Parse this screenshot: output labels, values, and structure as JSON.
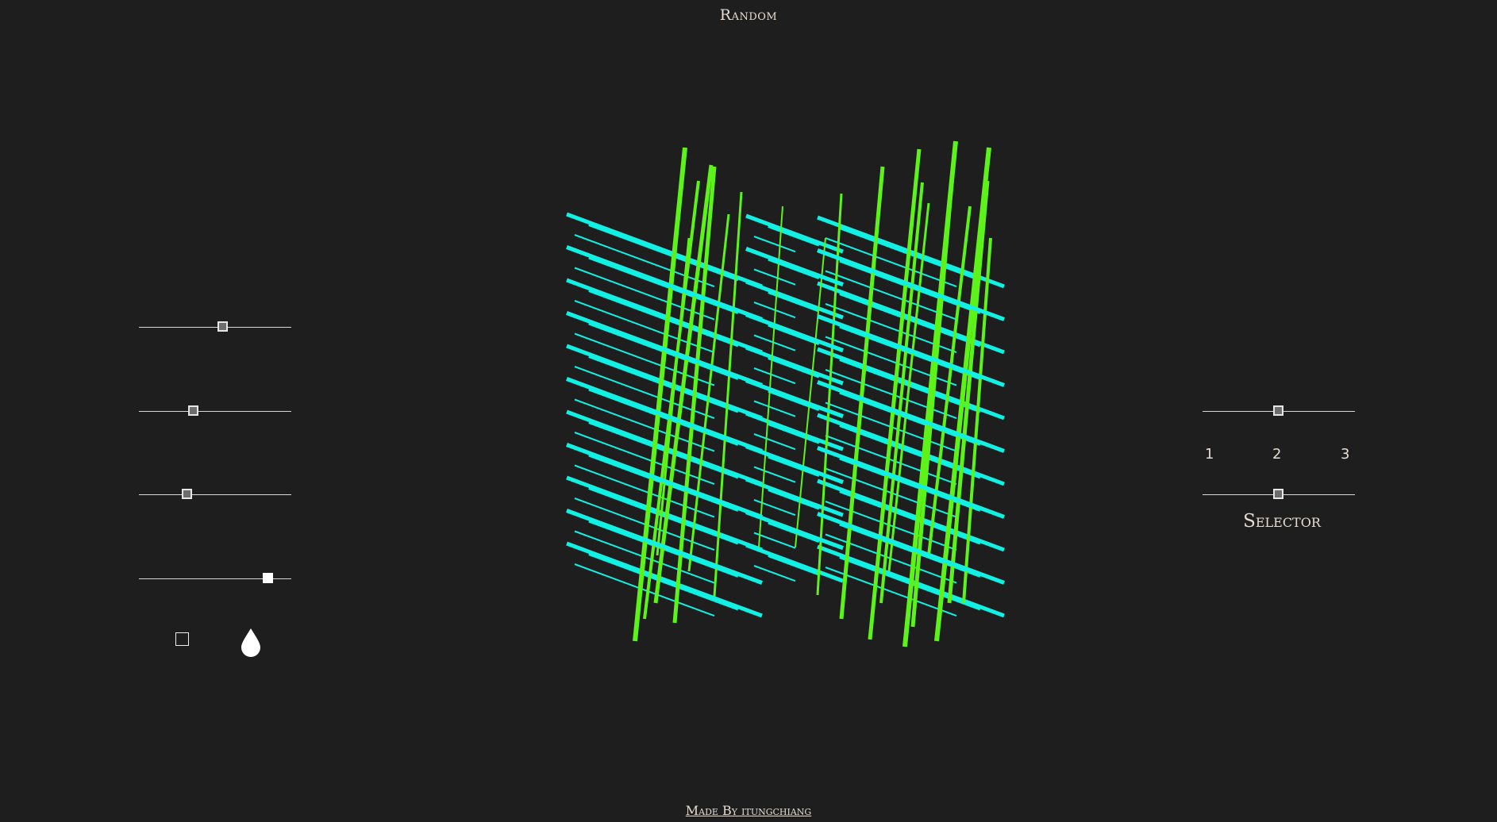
{
  "header": {
    "title": "Random"
  },
  "footer": {
    "credit": "Made By itungchiang"
  },
  "left_panel": {
    "sliders": [
      {
        "name": "slider-1",
        "value": 0.55
      },
      {
        "name": "slider-2",
        "value": 0.36
      },
      {
        "name": "slider-3",
        "value": 0.32
      },
      {
        "name": "slider-4",
        "value": 0.85
      }
    ],
    "buttons": [
      {
        "name": "square-shape-button",
        "icon": "square-outline-icon"
      },
      {
        "name": "ink-drop-button",
        "icon": "drop-icon"
      }
    ]
  },
  "right_panel": {
    "top_slider_value": 0.5,
    "selector_slider_value": 0.5,
    "selector_options": [
      "1",
      "2",
      "3"
    ],
    "selector_label": "Selector"
  },
  "artwork": {
    "green_color": "#5df21a",
    "cyan_color": "#12f0e4",
    "background_color": "#1e1e1e"
  }
}
